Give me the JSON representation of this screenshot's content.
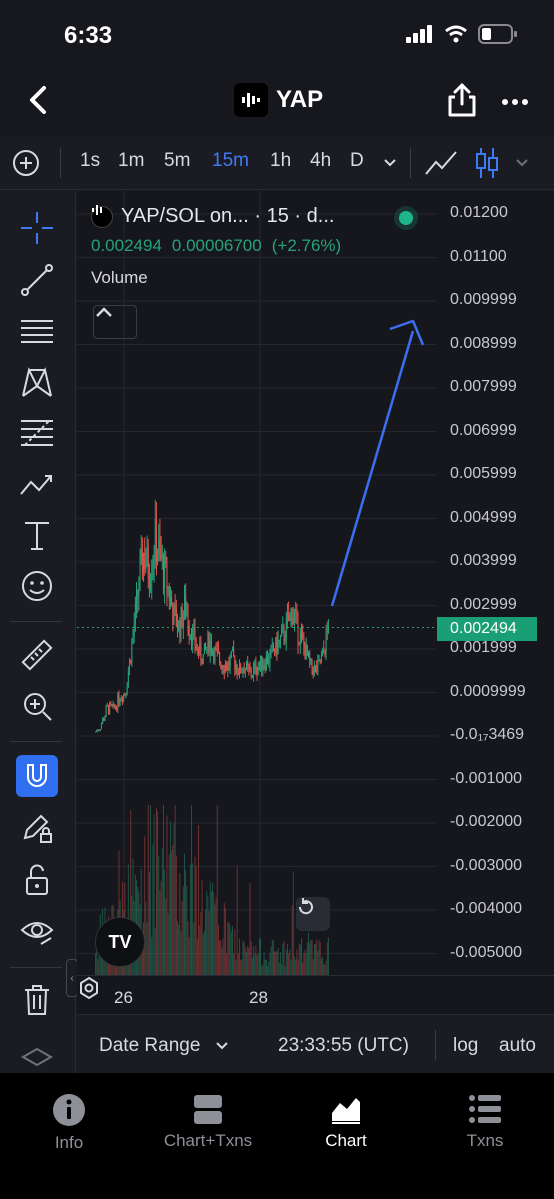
{
  "status_bar": {
    "time": "6:33"
  },
  "nav": {
    "title": "YAP"
  },
  "toolbar": {
    "timeframes": [
      "1s",
      "1m",
      "5m",
      "15m",
      "1h",
      "4h",
      "D"
    ],
    "active_timeframe": "15m",
    "accent": "#3d7bf5"
  },
  "legend": {
    "title": "YAP/SOL on... · 15 · d...",
    "price": "0.002494",
    "change_abs": "0.00006700",
    "change_pct": "(+2.76%)",
    "volume_label": "Volume"
  },
  "price_label": "0.002494",
  "chart_data": {
    "type": "candlestick",
    "y_ticks": [
      "0.01200",
      "0.01100",
      "0.009999",
      "0.008999",
      "0.007999",
      "0.006999",
      "0.005999",
      "0.004999",
      "0.003999",
      "0.002999",
      "0.001999",
      "0.0009999",
      "-0.0₁₇3469",
      "-0.001000",
      "-0.002000",
      "-0.003000",
      "-0.004000",
      "-0.005000"
    ],
    "x_ticks": [
      "26",
      "28"
    ],
    "up_color": "#26a17a",
    "down_color": "#e5534b",
    "price_series_approx": [
      0.0001,
      0.0003,
      0.00065,
      0.0006,
      0.0009,
      0.001,
      0.002,
      0.0032,
      0.0042,
      0.0038,
      0.0045,
      0.004,
      0.0035,
      0.0028,
      0.0025,
      0.003,
      0.0024,
      0.002,
      0.0018,
      0.0022,
      0.0019,
      0.0017,
      0.0016,
      0.0018,
      0.0015,
      0.0016,
      0.0014,
      0.0016,
      0.0017,
      0.0018,
      0.002,
      0.0022,
      0.0025,
      0.0029,
      0.0024,
      0.002,
      0.0016,
      0.0015,
      0.0018,
      0.00249
    ],
    "last_price": 0.002494,
    "annotation": "upward arrow"
  },
  "range_bar": {
    "label": "Date Range",
    "clock": "23:33:55 (UTC)",
    "log": "log",
    "auto": "auto"
  },
  "bottom_nav": [
    "Info",
    "Chart+Txns",
    "Chart",
    "Txns"
  ],
  "bottom_nav_active": "Chart"
}
